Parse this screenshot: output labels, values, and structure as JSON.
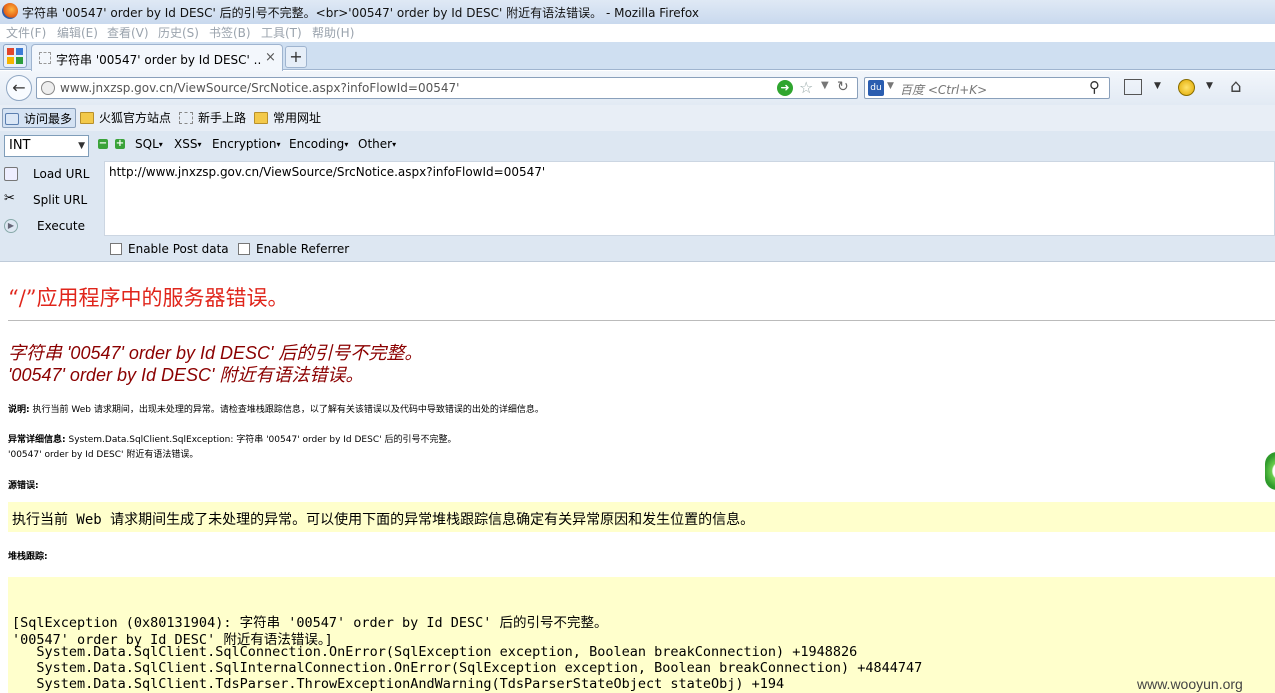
{
  "window": {
    "title": "字符串 '00547' order by Id DESC' 后的引号不完整。<br>'00547' order by Id DESC' 附近有语法错误。 - Mozilla Firefox"
  },
  "menubar": [
    "文件(F)",
    "编辑(E)",
    "查看(V)",
    "历史(S)",
    "书签(B)",
    "工具(T)",
    "帮助(H)"
  ],
  "tab": {
    "label": "字符串 '00547' order by Id DESC' ...",
    "close": "×",
    "new_tab": "+"
  },
  "navbar": {
    "url": "www.jnxzsp.gov.cn/ViewSource/SrcNotice.aspx?infoFlowId=00547'",
    "search_placeholder": "百度 <Ctrl+K>"
  },
  "bookmarks": [
    {
      "label": "访问最多"
    },
    {
      "label": "火狐官方站点"
    },
    {
      "label": "新手上路"
    },
    {
      "label": "常用网址"
    }
  ],
  "hackbar": {
    "type_select": "INT",
    "menus": [
      "SQL",
      "XSS",
      "Encryption",
      "Encoding",
      "Other"
    ],
    "load_url": "Load URL",
    "split_url": "Split URL",
    "execute": "Execute",
    "url_value": "http://www.jnxzsp.gov.cn/ViewSource/SrcNotice.aspx?infoFlowId=00547'",
    "enable_post": "Enable Post data",
    "enable_referrer": "Enable Referrer"
  },
  "page": {
    "app_error_title": "“/”应用程序中的服务器错误。",
    "error_line1": "字符串 '00547' order by Id DESC' 后的引号不完整。",
    "error_line2": "'00547' order by Id DESC' 附近有语法错误。",
    "desc_label": "说明:",
    "desc_text": "执行当前 Web 请求期间，出现未处理的异常。请检查堆栈跟踪信息，以了解有关该错误以及代码中导致错误的出处的详细信息。",
    "exception_label": "异常详细信息:",
    "exception_text": "System.Data.SqlClient.SqlException: 字符串 '00547' order by Id DESC' 后的引号不完整。",
    "exception_text2": "'00547' order by Id DESC' 附近有语法错误。",
    "source_error_label": "源错误:",
    "source_error_text": "执行当前 Web 请求期间生成了未处理的异常。可以使用下面的异常堆栈跟踪信息确定有关异常原因和发生位置的信息。",
    "stack_label": "堆栈跟踪:",
    "stack_lines": [
      "[SqlException (0x80131904): 字符串 '00547' order by Id DESC' 后的引号不完整。",
      "'00547' order by Id DESC' 附近有语法错误。]",
      "   System.Data.SqlClient.SqlConnection.OnError(SqlException exception, Boolean breakConnection) +1948826",
      "   System.Data.SqlClient.SqlInternalConnection.OnError(SqlException exception, Boolean breakConnection) +4844747",
      "   System.Data.SqlClient.TdsParser.ThrowExceptionAndWarning(TdsParserStateObject stateObj) +194"
    ]
  },
  "watermark": "www.wooyun.org",
  "colors": {
    "error_red": "#e0251b",
    "error_darkred": "#8b0000",
    "yellow_box": "#ffffcc"
  }
}
